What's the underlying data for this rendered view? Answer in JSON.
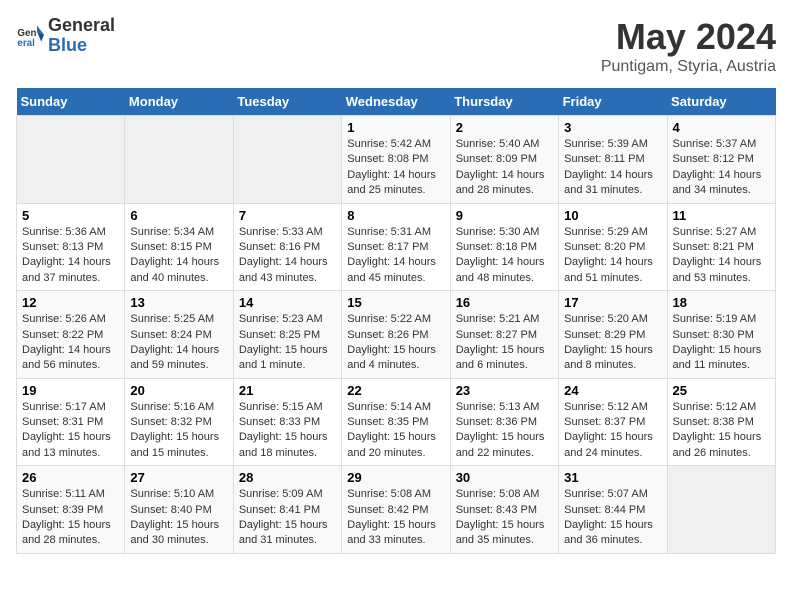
{
  "logo": {
    "general": "General",
    "blue": "Blue"
  },
  "title": "May 2024",
  "subtitle": "Puntigam, Styria, Austria",
  "days_header": [
    "Sunday",
    "Monday",
    "Tuesday",
    "Wednesday",
    "Thursday",
    "Friday",
    "Saturday"
  ],
  "weeks": [
    [
      {
        "day": "",
        "info": ""
      },
      {
        "day": "",
        "info": ""
      },
      {
        "day": "",
        "info": ""
      },
      {
        "day": "1",
        "info": "Sunrise: 5:42 AM\nSunset: 8:08 PM\nDaylight: 14 hours\nand 25 minutes."
      },
      {
        "day": "2",
        "info": "Sunrise: 5:40 AM\nSunset: 8:09 PM\nDaylight: 14 hours\nand 28 minutes."
      },
      {
        "day": "3",
        "info": "Sunrise: 5:39 AM\nSunset: 8:11 PM\nDaylight: 14 hours\nand 31 minutes."
      },
      {
        "day": "4",
        "info": "Sunrise: 5:37 AM\nSunset: 8:12 PM\nDaylight: 14 hours\nand 34 minutes."
      }
    ],
    [
      {
        "day": "5",
        "info": "Sunrise: 5:36 AM\nSunset: 8:13 PM\nDaylight: 14 hours\nand 37 minutes."
      },
      {
        "day": "6",
        "info": "Sunrise: 5:34 AM\nSunset: 8:15 PM\nDaylight: 14 hours\nand 40 minutes."
      },
      {
        "day": "7",
        "info": "Sunrise: 5:33 AM\nSunset: 8:16 PM\nDaylight: 14 hours\nand 43 minutes."
      },
      {
        "day": "8",
        "info": "Sunrise: 5:31 AM\nSunset: 8:17 PM\nDaylight: 14 hours\nand 45 minutes."
      },
      {
        "day": "9",
        "info": "Sunrise: 5:30 AM\nSunset: 8:18 PM\nDaylight: 14 hours\nand 48 minutes."
      },
      {
        "day": "10",
        "info": "Sunrise: 5:29 AM\nSunset: 8:20 PM\nDaylight: 14 hours\nand 51 minutes."
      },
      {
        "day": "11",
        "info": "Sunrise: 5:27 AM\nSunset: 8:21 PM\nDaylight: 14 hours\nand 53 minutes."
      }
    ],
    [
      {
        "day": "12",
        "info": "Sunrise: 5:26 AM\nSunset: 8:22 PM\nDaylight: 14 hours\nand 56 minutes."
      },
      {
        "day": "13",
        "info": "Sunrise: 5:25 AM\nSunset: 8:24 PM\nDaylight: 14 hours\nand 59 minutes."
      },
      {
        "day": "14",
        "info": "Sunrise: 5:23 AM\nSunset: 8:25 PM\nDaylight: 15 hours\nand 1 minute."
      },
      {
        "day": "15",
        "info": "Sunrise: 5:22 AM\nSunset: 8:26 PM\nDaylight: 15 hours\nand 4 minutes."
      },
      {
        "day": "16",
        "info": "Sunrise: 5:21 AM\nSunset: 8:27 PM\nDaylight: 15 hours\nand 6 minutes."
      },
      {
        "day": "17",
        "info": "Sunrise: 5:20 AM\nSunset: 8:29 PM\nDaylight: 15 hours\nand 8 minutes."
      },
      {
        "day": "18",
        "info": "Sunrise: 5:19 AM\nSunset: 8:30 PM\nDaylight: 15 hours\nand 11 minutes."
      }
    ],
    [
      {
        "day": "19",
        "info": "Sunrise: 5:17 AM\nSunset: 8:31 PM\nDaylight: 15 hours\nand 13 minutes."
      },
      {
        "day": "20",
        "info": "Sunrise: 5:16 AM\nSunset: 8:32 PM\nDaylight: 15 hours\nand 15 minutes."
      },
      {
        "day": "21",
        "info": "Sunrise: 5:15 AM\nSunset: 8:33 PM\nDaylight: 15 hours\nand 18 minutes."
      },
      {
        "day": "22",
        "info": "Sunrise: 5:14 AM\nSunset: 8:35 PM\nDaylight: 15 hours\nand 20 minutes."
      },
      {
        "day": "23",
        "info": "Sunrise: 5:13 AM\nSunset: 8:36 PM\nDaylight: 15 hours\nand 22 minutes."
      },
      {
        "day": "24",
        "info": "Sunrise: 5:12 AM\nSunset: 8:37 PM\nDaylight: 15 hours\nand 24 minutes."
      },
      {
        "day": "25",
        "info": "Sunrise: 5:12 AM\nSunset: 8:38 PM\nDaylight: 15 hours\nand 26 minutes."
      }
    ],
    [
      {
        "day": "26",
        "info": "Sunrise: 5:11 AM\nSunset: 8:39 PM\nDaylight: 15 hours\nand 28 minutes."
      },
      {
        "day": "27",
        "info": "Sunrise: 5:10 AM\nSunset: 8:40 PM\nDaylight: 15 hours\nand 30 minutes."
      },
      {
        "day": "28",
        "info": "Sunrise: 5:09 AM\nSunset: 8:41 PM\nDaylight: 15 hours\nand 31 minutes."
      },
      {
        "day": "29",
        "info": "Sunrise: 5:08 AM\nSunset: 8:42 PM\nDaylight: 15 hours\nand 33 minutes."
      },
      {
        "day": "30",
        "info": "Sunrise: 5:08 AM\nSunset: 8:43 PM\nDaylight: 15 hours\nand 35 minutes."
      },
      {
        "day": "31",
        "info": "Sunrise: 5:07 AM\nSunset: 8:44 PM\nDaylight: 15 hours\nand 36 minutes."
      },
      {
        "day": "",
        "info": ""
      }
    ]
  ]
}
